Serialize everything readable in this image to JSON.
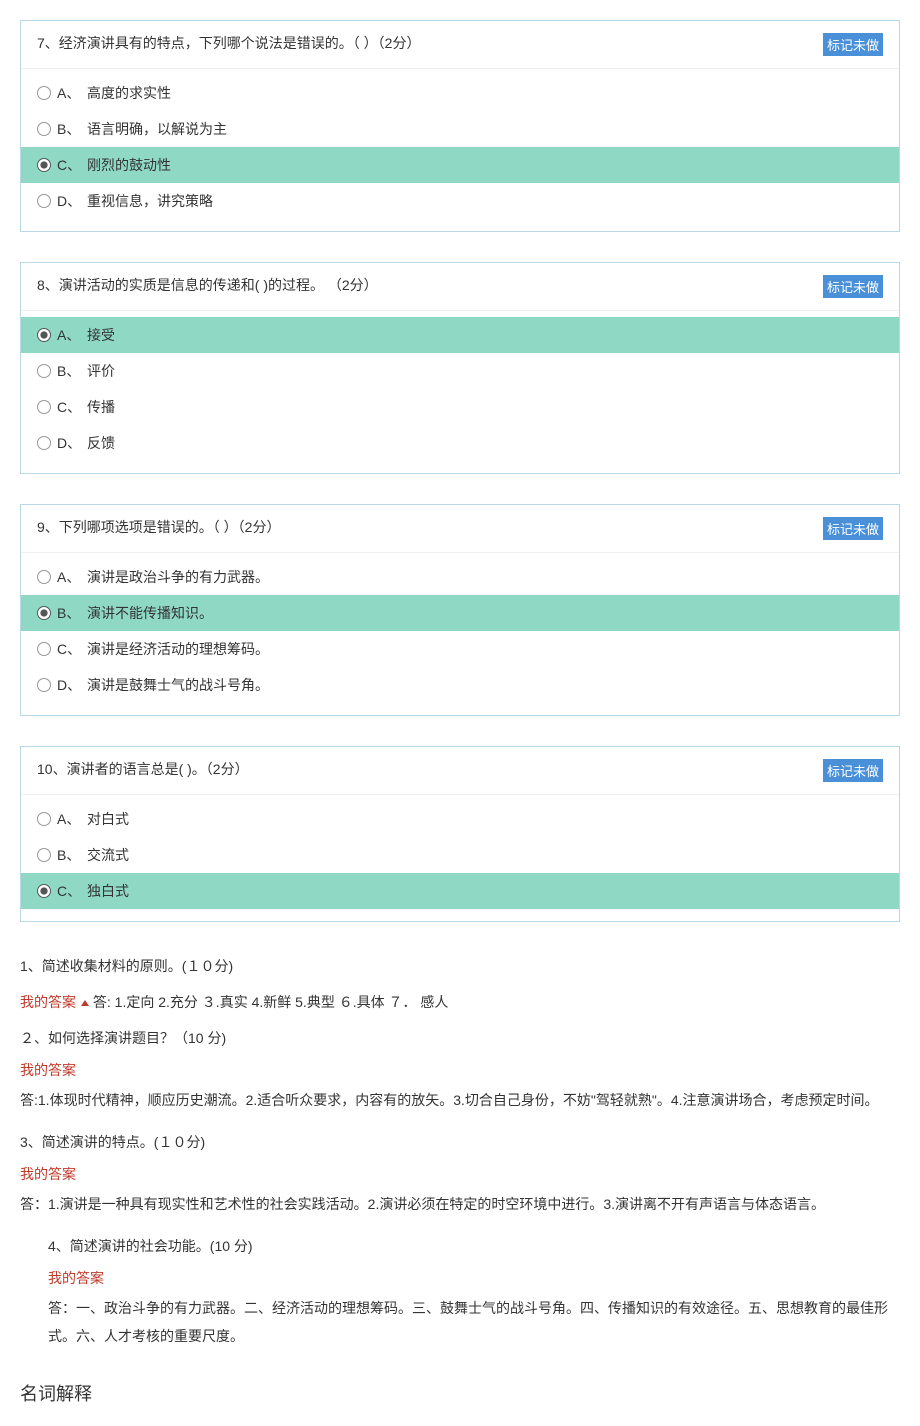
{
  "mark_label": "标记未做",
  "questions": [
    {
      "title": "7、经济演讲具有的特点，下列哪个说法是错误的。（  ）（2分）",
      "opts": [
        {
          "k": "A、",
          "t": "高度的求实性",
          "sel": false
        },
        {
          "k": "B、",
          "t": "语言明确，以解说为主",
          "sel": false
        },
        {
          "k": "C、",
          "t": "刚烈的鼓动性",
          "sel": true
        },
        {
          "k": "D、",
          "t": "重视信息，讲究策略",
          "sel": false
        }
      ]
    },
    {
      "title": "8、演讲活动的实质是信息的传递和(    )的过程。 （2分）",
      "opts": [
        {
          "k": "A、",
          "t": "接受",
          "sel": true
        },
        {
          "k": "B、",
          "t": "评价",
          "sel": false
        },
        {
          "k": "C、",
          "t": "传播",
          "sel": false
        },
        {
          "k": "D、",
          "t": "反馈",
          "sel": false
        }
      ]
    },
    {
      "title": "9、下列哪项选项是错误的。（  ）（2分）",
      "opts": [
        {
          "k": "A、",
          "t": "演讲是政治斗争的有力武器。",
          "sel": false
        },
        {
          "k": "B、",
          "t": "演讲不能传播知识。",
          "sel": true
        },
        {
          "k": "C、",
          "t": "演讲是经济活动的理想筹码。",
          "sel": false
        },
        {
          "k": "D、",
          "t": "演讲是鼓舞士气的战斗号角。",
          "sel": false
        }
      ]
    },
    {
      "title": "10、演讲者的语言总是(   )。（2分）",
      "opts": [
        {
          "k": "A、",
          "t": "对白式",
          "sel": false
        },
        {
          "k": "B、",
          "t": "交流式",
          "sel": false
        },
        {
          "k": "C、",
          "t": "独白式",
          "sel": true
        }
      ]
    }
  ],
  "essay": {
    "q1": "1、简述收集材料的原则。(１０分)",
    "a1_label": "我的答案",
    "a1": "答: 1.定向 2.充分 ３.真实 4.新鲜 5.典型 ６.具体 ７． 感人",
    "q2": "２、如何选择演讲题目？（10 分)",
    "a2_label": "我的答案",
    "a2": "答:1.体现时代精神，顺应历史潮流。2.适合听众要求，内容有的放矢。3.切合自己身份，不妨\"驾轻就熟\"。4.注意演讲场合，考虑预定时间。",
    "q3": "3、简述演讲的特点。(１０分)",
    "a3_label": "我的答案",
    "a3": "答：1.演讲是一种具有现实性和艺术性的社会实践活动。2.演讲必须在特定的时空环境中进行。3.演讲离不开有声语言与体态语言。",
    "q4": "4、简述演讲的社会功能。(10 分)",
    "a4_label": "我的答案",
    "a4": "答：一、政治斗争的有力武器。二、经济活动的理想筹码。三、鼓舞士气的战斗号角。四、传播知识的有效途径。五、思想教育的最佳形式。六、人才考核的重要尺度。"
  },
  "section_title": "名词解释"
}
